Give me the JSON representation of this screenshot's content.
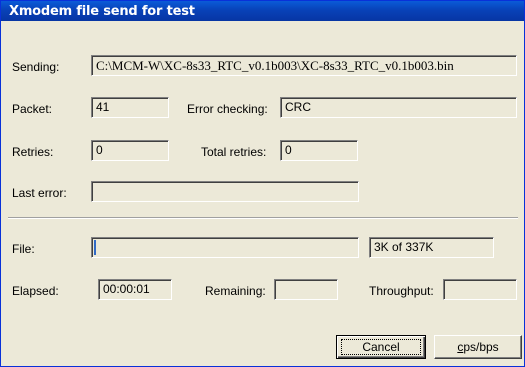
{
  "window": {
    "title": "Xmodem file send for test"
  },
  "sending": {
    "label": "Sending:",
    "value": "C:\\MCM-W\\XC-8s33_RTC_v0.1b003\\XC-8s33_RTC_v0.1b003.bin"
  },
  "packet": {
    "label": "Packet:",
    "value": "41"
  },
  "error_checking": {
    "label": "Error checking:",
    "value": "CRC"
  },
  "retries": {
    "label": "Retries:",
    "value": "0"
  },
  "total_retries": {
    "label": "Total retries:",
    "value": "0"
  },
  "last_error": {
    "label": "Last error:",
    "value": ""
  },
  "file": {
    "label": "File:",
    "progress": 0.0089,
    "status": "3K of 337K"
  },
  "elapsed": {
    "label": "Elapsed:",
    "value": "00:00:01"
  },
  "remaining": {
    "label": "Remaining:",
    "value": ""
  },
  "throughput": {
    "label": "Throughput:",
    "value": ""
  },
  "buttons": {
    "cancel": "Cancel",
    "cps_mnemonic": "c",
    "cps_rest": "ps/bps"
  },
  "colors": {
    "title_bar": "#0842b8",
    "face": "#ece9d8"
  }
}
